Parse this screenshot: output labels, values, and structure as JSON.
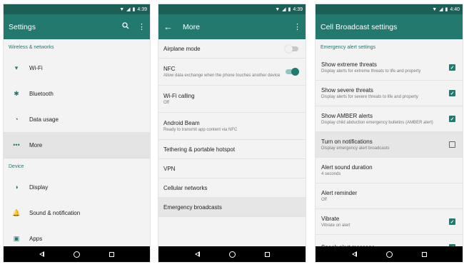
{
  "colors": {
    "primary": "#24796f",
    "status": "#1d5f57",
    "accent": "#24796f"
  },
  "screen1": {
    "status_time": "4:39",
    "title": "Settings",
    "sections": [
      {
        "header": "Wireless & networks",
        "items": [
          {
            "icon": "wifi-icon",
            "glyph": "▾",
            "label": "Wi-Fi"
          },
          {
            "icon": "bluetooth-icon",
            "glyph": "✱",
            "label": "Bluetooth"
          },
          {
            "icon": "data-usage-icon",
            "glyph": "◔",
            "label": "Data usage"
          },
          {
            "icon": "more-dots-icon",
            "glyph": "•••",
            "label": "More",
            "selected": true
          }
        ]
      },
      {
        "header": "Device",
        "items": [
          {
            "icon": "display-icon",
            "glyph": "◑",
            "label": "Display"
          },
          {
            "icon": "bell-icon",
            "glyph": "🔔",
            "label": "Sound & notification"
          },
          {
            "icon": "android-icon",
            "glyph": "▣",
            "label": "Apps"
          }
        ]
      }
    ]
  },
  "screen2": {
    "status_time": "4:39",
    "title": "More",
    "items": [
      {
        "label": "Airplane mode",
        "toggle": "off"
      },
      {
        "label": "NFC",
        "sub": "Allow data exchange when the phone touches another device",
        "toggle": "on"
      },
      {
        "label": "Wi-Fi calling",
        "sub": "Off"
      },
      {
        "label": "Android Beam",
        "sub": "Ready to transmit app content via NFC"
      },
      {
        "label": "Tethering & portable hotspot"
      },
      {
        "label": "VPN"
      },
      {
        "label": "Cellular networks"
      },
      {
        "label": "Emergency broadcasts",
        "selected": true
      }
    ]
  },
  "screen3": {
    "status_time": "4:40",
    "title": "Cell Broadcast settings",
    "section_header": "Emergency alert settings",
    "items": [
      {
        "label": "Show extreme threats",
        "sub": "Display alerts for extreme threats to life and property",
        "check": "on"
      },
      {
        "label": "Show severe threats",
        "sub": "Display alerts for severe threats to life and property",
        "check": "on"
      },
      {
        "label": "Show AMBER alerts",
        "sub": "Display child abduction emergency bulletins (AMBER alert)",
        "check": "on"
      },
      {
        "label": "Turn on notifications",
        "sub": "Display emergency alert broadcasts",
        "check": "off",
        "selected": true
      },
      {
        "label": "Alert sound duration",
        "sub": "4 seconds"
      },
      {
        "label": "Alert reminder",
        "sub": "Off"
      },
      {
        "label": "Vibrate",
        "sub": "Vibrate on alert",
        "check": "on"
      },
      {
        "label": "Speak alert message",
        "check": "on"
      }
    ]
  }
}
